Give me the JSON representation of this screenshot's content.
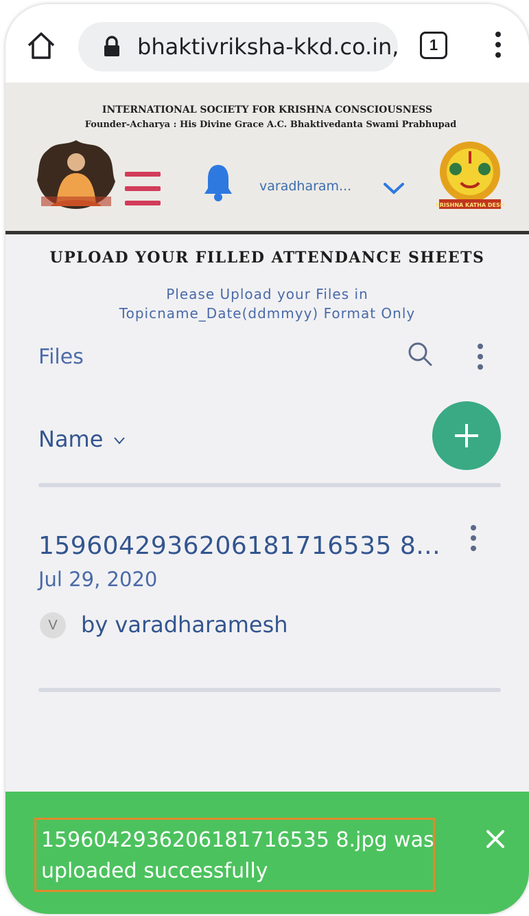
{
  "browser": {
    "url": "bhaktivriksha-kkd.co.in,",
    "tab_count": "1"
  },
  "header": {
    "org_name": "INTERNATIONAL SOCIETY FOR KRISHNA CONSCIOUSNESS",
    "founder_line": "Founder-Acharya : His Divine Grace A.C. Bhaktivedanta Swami Prabhupad",
    "user_name": "varadharam...",
    "right_logo_caption": "KRISHNA KATHA DESH",
    "accent_color": "#d23c5a"
  },
  "main": {
    "section_title": "UPLOAD YOUR FILLED ATTENDANCE SHEETS",
    "instruction_line1": "Please Upload your Files in",
    "instruction_line2": "Topicname_Date(ddmmyy) Format Only",
    "files_label": "Files",
    "sort_label": "Name",
    "fab_color": "#3aaa84"
  },
  "file": {
    "name": "1596042936206181716535 8...",
    "date": "Jul 29, 2020",
    "avatar_letter": "V",
    "owner": "by varadharamesh"
  },
  "toast": {
    "message": "1596042936206181716535 8.jpg was uploaded successfully",
    "color": "#4cc25e"
  }
}
